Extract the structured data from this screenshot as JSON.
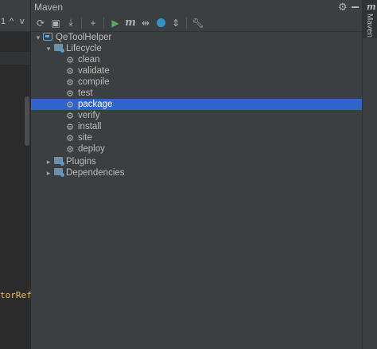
{
  "editor": {
    "line_number": "1",
    "up_chevron": "^",
    "down_chevron": "v",
    "code_fragment": "torRef>"
  },
  "maven": {
    "title": "Maven",
    "toolbar": {
      "reload_icon": "reload-icon",
      "add_project_icon": "add-project-icon",
      "download_icon": "download-icon",
      "add_icon": "+",
      "run_icon": "▶",
      "execute_goal_icon": "m",
      "toggle_offline_icon": "toggle-offline-icon",
      "skip_tests_icon": "skip-tests-icon",
      "collapse_icon": "collapse-all-icon",
      "settings_icon": "wrench-icon"
    },
    "tree": {
      "project": "QeToolHelper",
      "lifecycle": "Lifecycle",
      "goals": [
        "clean",
        "validate",
        "compile",
        "test",
        "package",
        "verify",
        "install",
        "site",
        "deploy"
      ],
      "selected_goal": "package",
      "plugins": "Plugins",
      "dependencies": "Dependencies"
    }
  },
  "stripe": {
    "icon": "m",
    "label": "Maven"
  },
  "colors": {
    "panel_bg": "#3c3f41",
    "editor_bg": "#2b2b2b",
    "selection": "#2f65ca",
    "run_green": "#59a869",
    "accent_blue": "#3592c4"
  }
}
